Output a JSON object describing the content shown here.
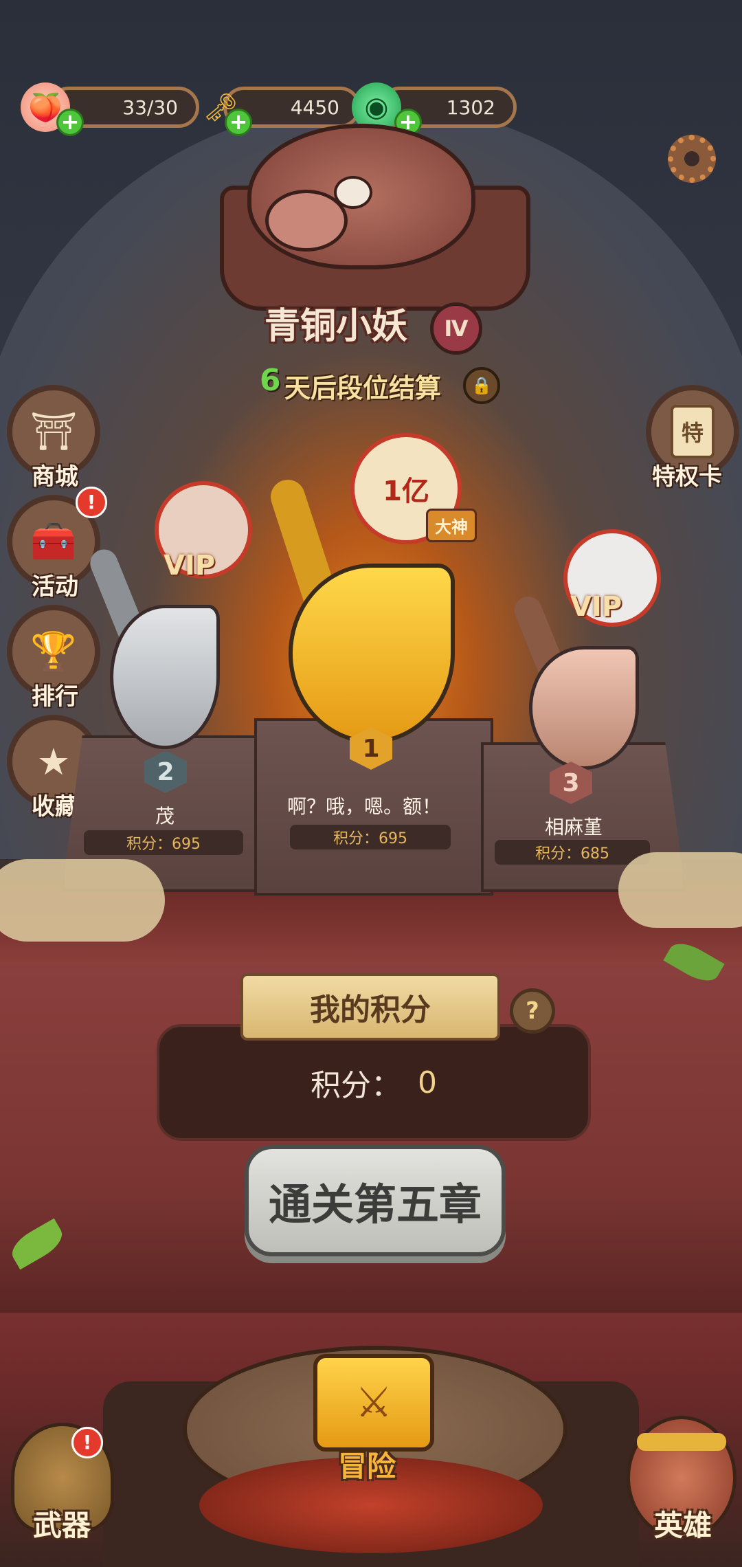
{
  "resources": [
    {
      "id": "stamina",
      "icon": "peach-icon",
      "value": "33/30"
    },
    {
      "id": "gold",
      "icon": "ingot-icon",
      "value": "4450"
    },
    {
      "id": "jade",
      "icon": "jade-icon",
      "value": "1302"
    }
  ],
  "rank": {
    "title": "青铜小妖",
    "tier": "Ⅳ",
    "countdown_num": "6",
    "countdown_text": "天后段位结算"
  },
  "left_menu": [
    {
      "label": "商城",
      "icon": "shop-icon",
      "alert": false
    },
    {
      "label": "活动",
      "icon": "chest-icon",
      "alert": true
    },
    {
      "label": "排行",
      "icon": "trophy-icon",
      "alert": false
    },
    {
      "label": "收藏",
      "icon": "star-icon",
      "alert": false
    }
  ],
  "right_menu": {
    "label": "特权卡",
    "icon": "privilege-card-icon",
    "icon_text": "特"
  },
  "podium": {
    "first": {
      "rank": "1",
      "name": "啊？哦，嗯。额！",
      "score": "积分：695",
      "badge": "大神",
      "avatar_text": "1亿"
    },
    "second": {
      "rank": "2",
      "name": "茂",
      "score": "积分：695",
      "badge": "VIP"
    },
    "third": {
      "rank": "3",
      "name": "相麻堇",
      "score": "积分：685",
      "badge": "VIP"
    }
  },
  "my_score": {
    "title": "我的积分",
    "label": "积分：",
    "value": "0",
    "help": "?"
  },
  "unlock_button": "通关第五章",
  "bottom_nav": {
    "weapon": "武器",
    "adventure": "冒险",
    "hero": "英雄",
    "alert": "!"
  },
  "icons": {
    "badge_alert": "!"
  }
}
